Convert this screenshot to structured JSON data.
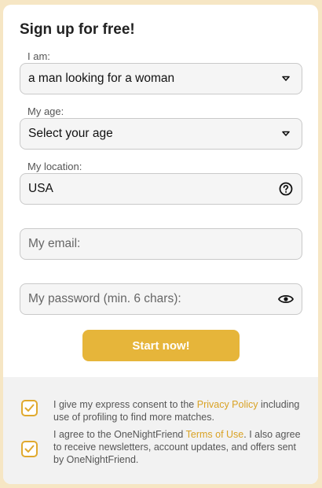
{
  "form": {
    "title": "Sign up for free!",
    "iam": {
      "label": "I am:",
      "value": "a man looking for a woman",
      "icon": "chevron-down-icon"
    },
    "age": {
      "label": "My age:",
      "value": "Select your age",
      "icon": "chevron-down-icon"
    },
    "location": {
      "label": "My location:",
      "value": "USA",
      "icon": "help-icon"
    },
    "email": {
      "placeholder": "My email:"
    },
    "password": {
      "placeholder": "My password (min. 6 chars):",
      "icon": "eye-icon"
    },
    "submit_label": "Start now!"
  },
  "consents": [
    {
      "checked": true,
      "text_before": "I give my express consent to the ",
      "link_text": "Privacy Policy",
      "text_after": " including use of profiling to find more matches."
    },
    {
      "checked": true,
      "text_before": "I agree to the OneNightFriend ",
      "link_text": "Terms of Use",
      "text_after": ". I also agree to receive newsletters, account updates, and offers sent by OneNightFriend."
    }
  ],
  "colors": {
    "page_background": "#f6e6c4",
    "accent": "#e6b53a",
    "link": "#d9a224",
    "field_background": "#f5f5f5"
  }
}
